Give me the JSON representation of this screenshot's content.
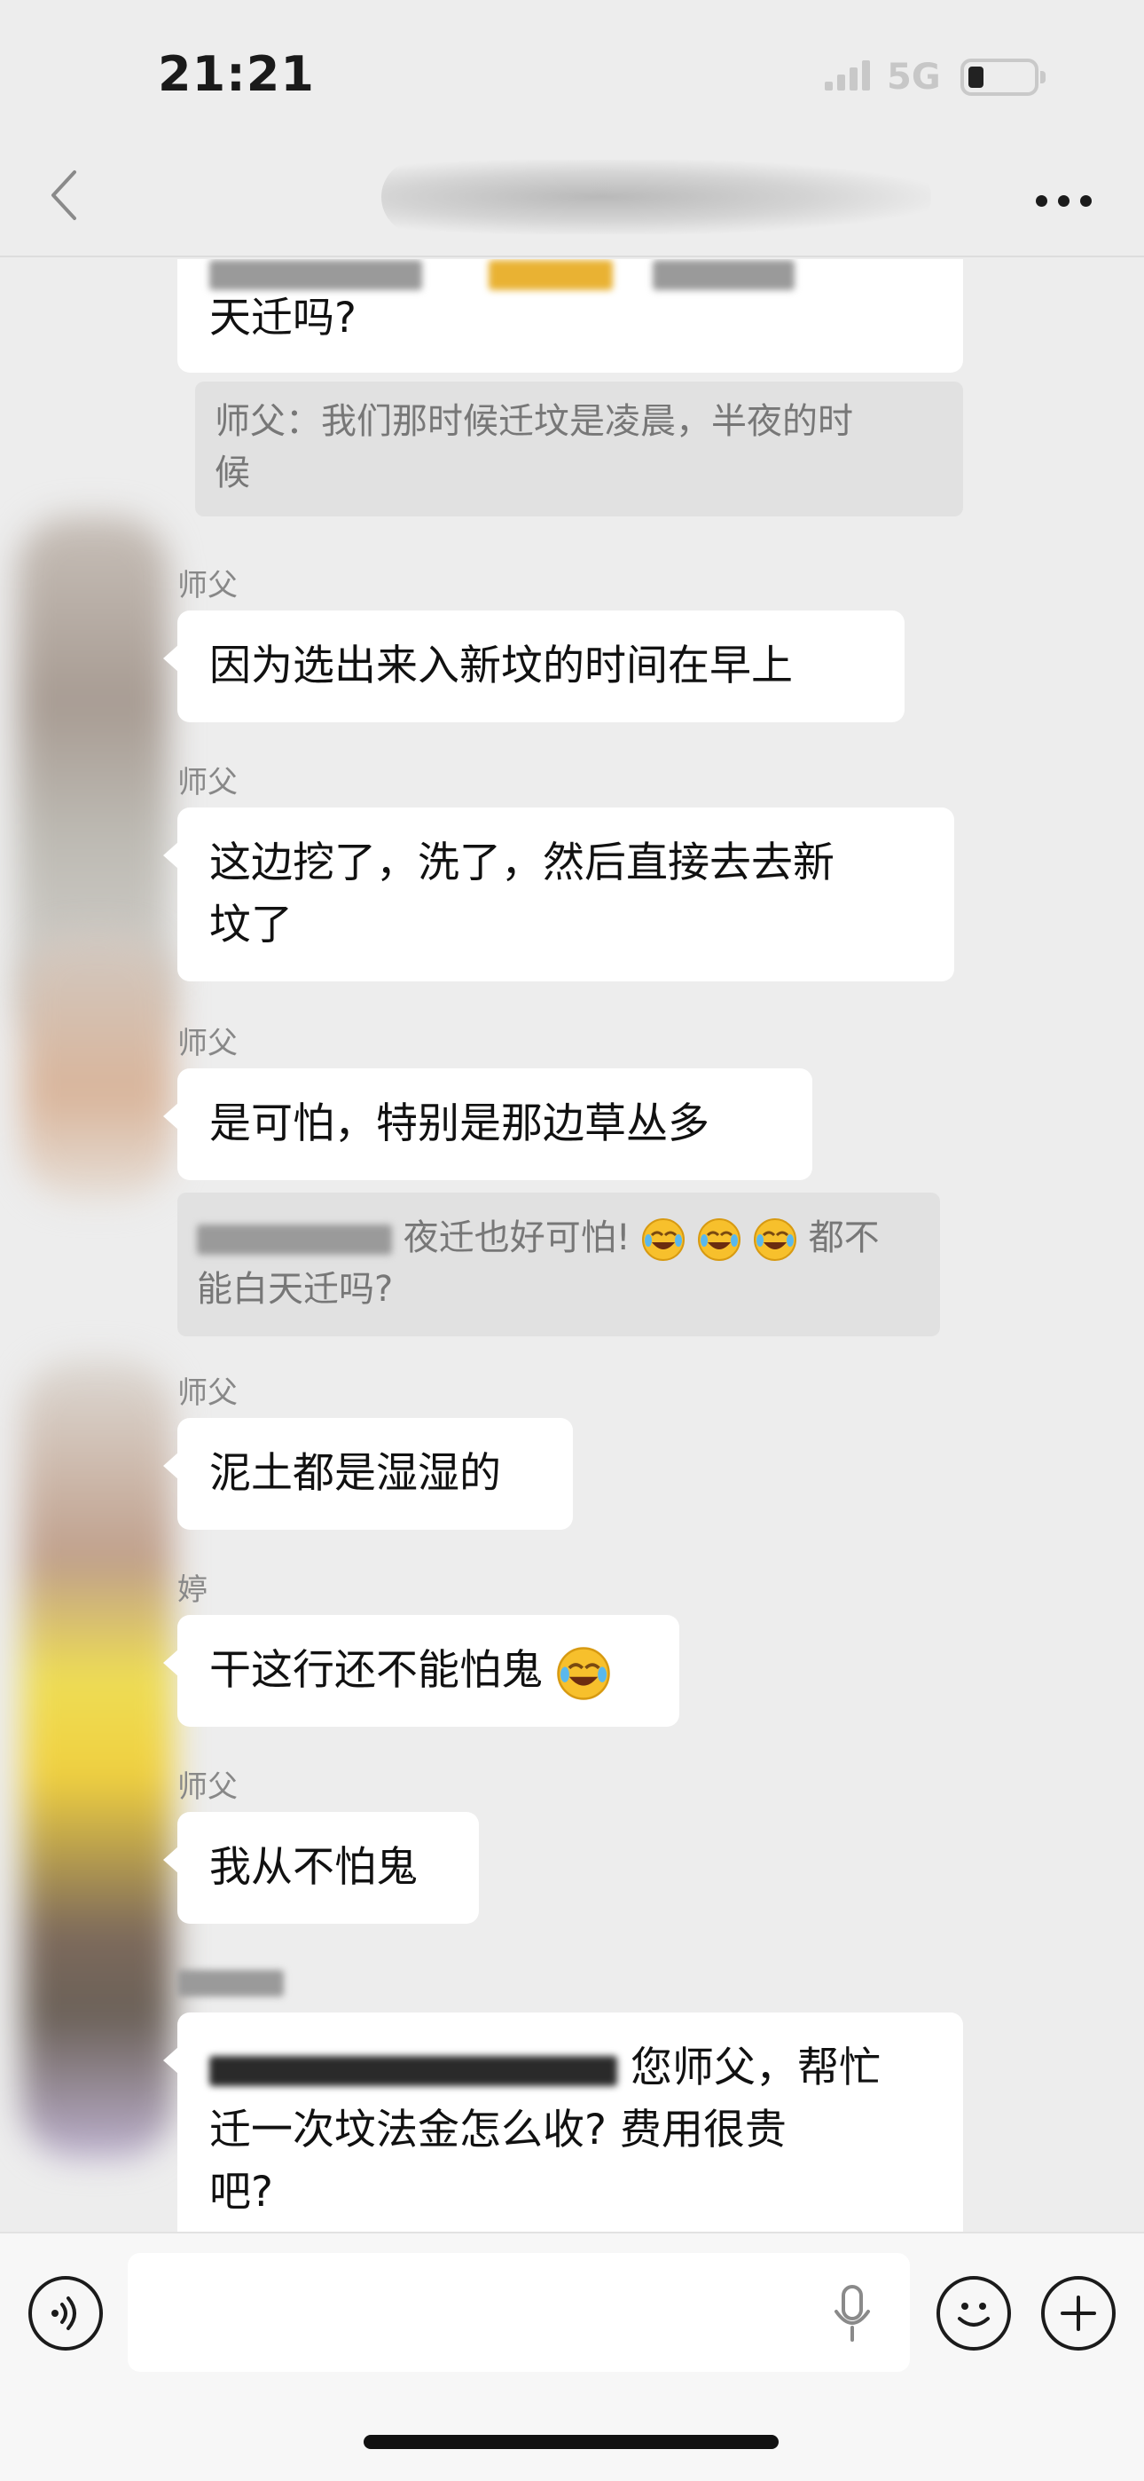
{
  "status_bar": {
    "time": "21:21",
    "network": "5G"
  },
  "nav": {
    "title": ""
  },
  "messages": [
    {
      "type": "bubble",
      "text": "天迁吗?"
    },
    {
      "type": "quote",
      "line1": "师父：我们那时候迁坟是凌晨，半夜的时",
      "line2": "候"
    },
    {
      "type": "bubble",
      "sender": "师父",
      "text": "因为选出来入新坟的时间在早上"
    },
    {
      "type": "bubble",
      "sender": "师父",
      "line1": "这边挖了，洗了，然后直接去去新",
      "line2": "坟了"
    },
    {
      "type": "bubble",
      "sender": "师父",
      "text": "是可怕，特别是那边草丛多"
    },
    {
      "type": "quote",
      "line1": "夜迁也好可怕!",
      "line1_tail": "都不",
      "line2": "能白天迁吗?"
    },
    {
      "type": "bubble",
      "sender": "师父",
      "text": "泥土都是湿湿的"
    },
    {
      "type": "bubble",
      "sender": "婷",
      "text": "干这行还不能怕鬼"
    },
    {
      "type": "bubble",
      "sender": "师父",
      "text": "我从不怕鬼"
    },
    {
      "type": "bubble",
      "line1": "您师父，帮忙",
      "line2": "迁一次坟法金怎么收? 费用很贵",
      "line3": "吧?"
    }
  ],
  "input": {
    "placeholder": ""
  },
  "icons": {
    "voice": "voice-icon",
    "mic": "mic-icon",
    "emoji": "emoji-icon",
    "plus": "plus-icon",
    "back": "back-icon",
    "more": "more-icon"
  },
  "colors": {
    "background": "#ededed",
    "bubble": "#ffffff",
    "quote": "#e1e1e1"
  }
}
